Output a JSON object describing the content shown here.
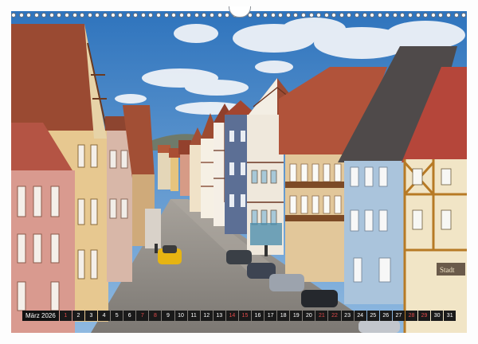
{
  "calendar": {
    "month_label": "März",
    "year_label": "2026",
    "days": [
      "1",
      "2",
      "3",
      "4",
      "5",
      "6",
      "7",
      "8",
      "9",
      "10",
      "11",
      "12",
      "13",
      "14",
      "15",
      "16",
      "17",
      "18",
      "19",
      "20",
      "21",
      "22",
      "23",
      "24",
      "25",
      "26",
      "27",
      "28",
      "29",
      "30",
      "31"
    ],
    "weekend_days": [
      "1",
      "7",
      "8",
      "14",
      "15",
      "21",
      "22",
      "28",
      "29"
    ]
  },
  "sign": {
    "text": "Stadt"
  },
  "colors": {
    "sky": "#3b7fc4",
    "cloud": "#f2f4f8",
    "roof": "#9a4a32",
    "street": "#8d8a86",
    "weekend": "#e24b4b"
  }
}
